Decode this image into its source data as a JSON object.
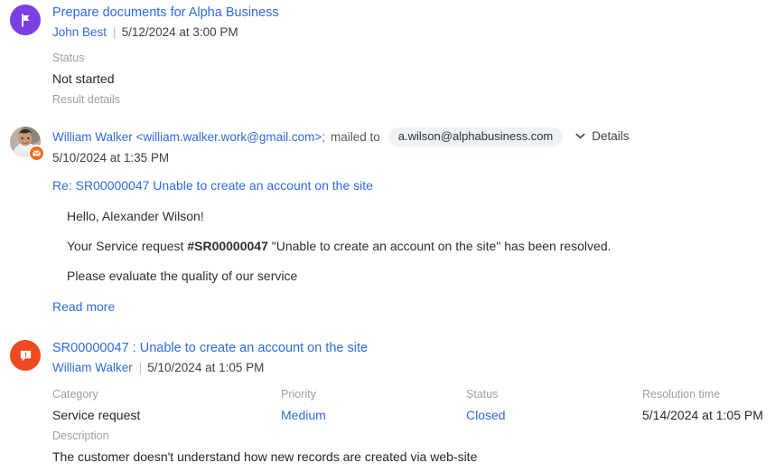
{
  "colors": {
    "link": "#2f6bdc",
    "label": "#9aa0a6",
    "task_icon_bg": "#7b3fe4",
    "case_icon_bg": "#ee4a1f",
    "envelope_badge": "#f26b21",
    "recipient_pill_bg": "#eef1f6"
  },
  "task": {
    "icon": "flag-icon",
    "title": "Prepare documents for Alpha Business",
    "author": "John Best",
    "separator": "|",
    "date": "5/12/2024 at 3:00 PM",
    "fields": [
      {
        "label": "Status",
        "value": "Not started"
      }
    ],
    "result_details_label": "Result details"
  },
  "email": {
    "avatar": "user-photo-avatar",
    "badge_icon": "envelope-icon",
    "from": "William Walker <william.walker.work@gmail.com>;",
    "mailed_to_label": "mailed to",
    "recipient": "a.wilson@alphabusiness.com",
    "details_label": "Details",
    "chevron_icon": "chevron-down-icon",
    "date": "5/10/2024 at 1:35 PM",
    "subject": "Re: SR00000047 Unable to create an account on the site",
    "body": [
      {
        "text": "Hello, Alexander Wilson!"
      },
      {
        "prefix": "Your Service request ",
        "bold": "#SR00000047",
        "suffix": " \"Unable to create an account on the site\" has been resolved."
      },
      {
        "text": "Please evaluate the quality of our service"
      }
    ],
    "read_more_label": "Read more"
  },
  "case": {
    "icon": "speech-bubble-alert-icon",
    "title": "SR00000047 : Unable to create an account on the site",
    "author": "William Walker",
    "separator": "|",
    "date": "5/10/2024 at 1:05 PM",
    "fields": [
      {
        "label": "Category",
        "value": "Service request",
        "link": false
      },
      {
        "label": "Priority",
        "value": "Medium",
        "link": true
      },
      {
        "label": "Status",
        "value": "Closed",
        "link": true
      },
      {
        "label": "Resolution time",
        "value": "5/14/2024 at 1:05 PM",
        "link": false
      }
    ],
    "description_label": "Description",
    "description_value": "The customer doesn't understand how new records are created via web-site"
  }
}
